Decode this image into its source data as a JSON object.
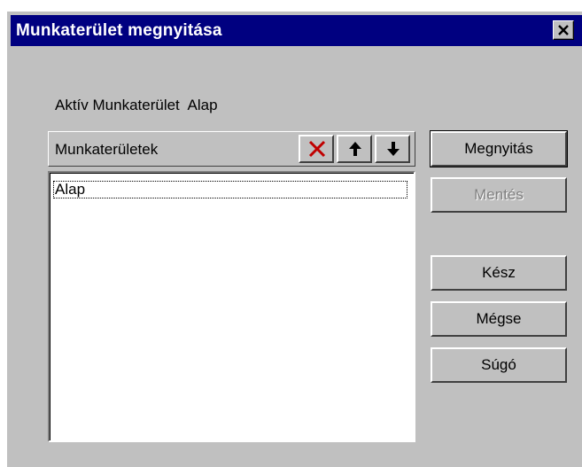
{
  "window": {
    "title": "Munkaterület megnyitása",
    "close_icon": "close-icon"
  },
  "active": {
    "label": "Aktív Munkaterület",
    "value": "Alap"
  },
  "list": {
    "header": "Munkaterületek",
    "tools": [
      {
        "name": "delete",
        "icon": "delete-x-icon",
        "color": "#c00000"
      },
      {
        "name": "move-up",
        "icon": "arrow-up-icon"
      },
      {
        "name": "move-down",
        "icon": "arrow-down-icon"
      }
    ],
    "items": [
      "Alap"
    ]
  },
  "buttons": {
    "open": "Megnyitás",
    "save": "Mentés",
    "done": "Kész",
    "cancel": "Mégse",
    "help": "Súgó"
  },
  "colors": {
    "titlebar": "#000080",
    "dialog": "#c0c0c0"
  }
}
